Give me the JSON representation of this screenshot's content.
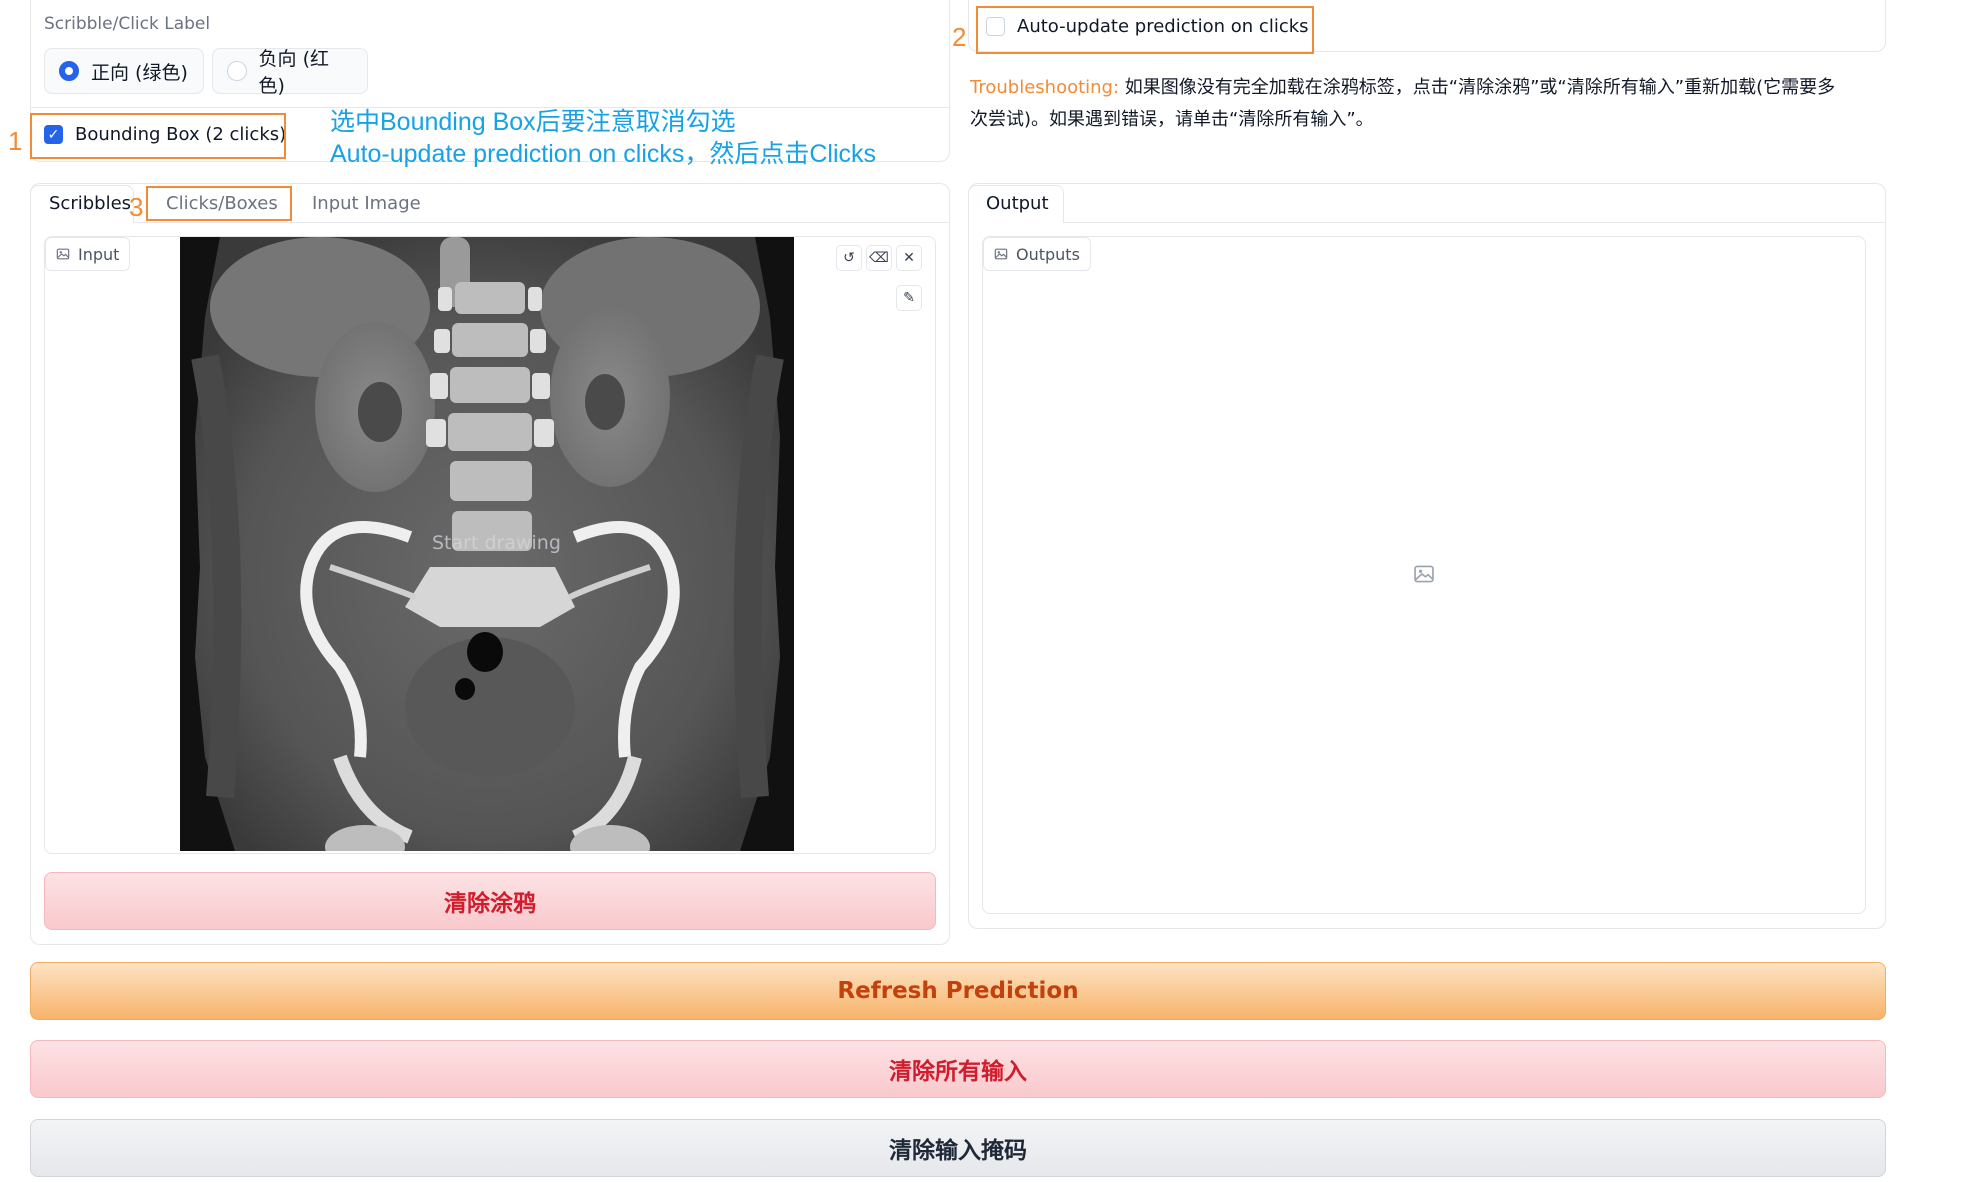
{
  "label_section": {
    "title": "Scribble/Click Label",
    "options": [
      {
        "label": "正向 (绿色)",
        "selected": true
      },
      {
        "label": "负向 (红色)",
        "selected": false
      }
    ]
  },
  "bounding_box": {
    "label": "Bounding Box (2 clicks)",
    "checked": true
  },
  "auto_update": {
    "label": "Auto-update prediction on clicks",
    "checked": false
  },
  "annotation_numbers": {
    "one": "1",
    "two": "2",
    "three": "3"
  },
  "annotation_text": {
    "line1": "选中Bounding Box后要注意取消勾选",
    "line2": "Auto-update prediction on clicks，然后点击Clicks"
  },
  "troubleshooting": {
    "prefix": "Troubleshooting:",
    "line1_rest": " 如果图像没有完全加载在涂鸦标签，点击“清除涂鸦”或“清除所有输入”重新加载(它需要多",
    "line2": "次尝试)。如果遇到错误，请单击“清除所有输入”。"
  },
  "input_tabs": [
    {
      "label": "Scribbles",
      "active": true
    },
    {
      "label": "Clicks/Boxes",
      "active": false
    },
    {
      "label": "Input Image",
      "active": false
    }
  ],
  "output_tab": {
    "label": "Output"
  },
  "input_chip": "Input",
  "outputs_chip": "Outputs",
  "canvas_placeholder": "Start drawing",
  "buttons": {
    "clear_scribbles": "清除涂鸦",
    "refresh": "Refresh Prediction",
    "clear_all": "清除所有输入",
    "clear_mask": "清除输入掩码"
  },
  "icons": {
    "undo": "undo-icon",
    "erase": "eraser-icon",
    "close": "close-icon",
    "brush": "brush-icon",
    "image": "image-icon"
  },
  "colors": {
    "accent_blue": "#2563eb",
    "annotation_orange": "#f28b35",
    "annotation_blue": "#17a2e6"
  }
}
